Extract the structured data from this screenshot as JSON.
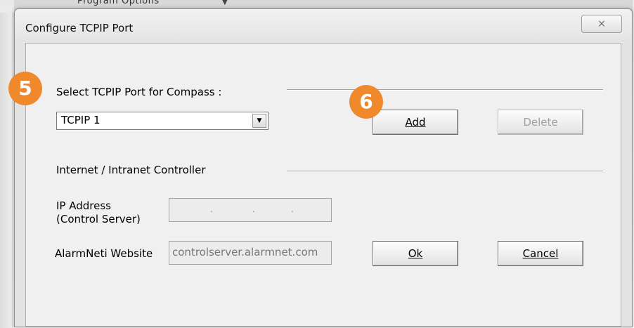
{
  "backdrop": {
    "text": "Program Options",
    "arrow": "▼"
  },
  "dialog": {
    "title": "Configure TCPIP Port",
    "close_icon": "×"
  },
  "port_section": {
    "label": "Select TCPIP Port for Compass :",
    "selected_port": "TCPIP 1",
    "dropdown_arrow": "▼",
    "add_label": "Add",
    "delete_label": "Delete"
  },
  "controller_section": {
    "label": "Internet / Intranet Controller",
    "ip_label_line1": "IP Address",
    "ip_label_line2": "(Control Server)",
    "ip_value": ". . .",
    "website_label": "AlarmNeti Website",
    "website_value": "controlserver.alarmnet.com"
  },
  "footer": {
    "ok_label": "Ok",
    "cancel_label": "Cancel"
  },
  "badges": {
    "step_a": "5",
    "step_b": "6",
    "color": "#f0892c"
  }
}
